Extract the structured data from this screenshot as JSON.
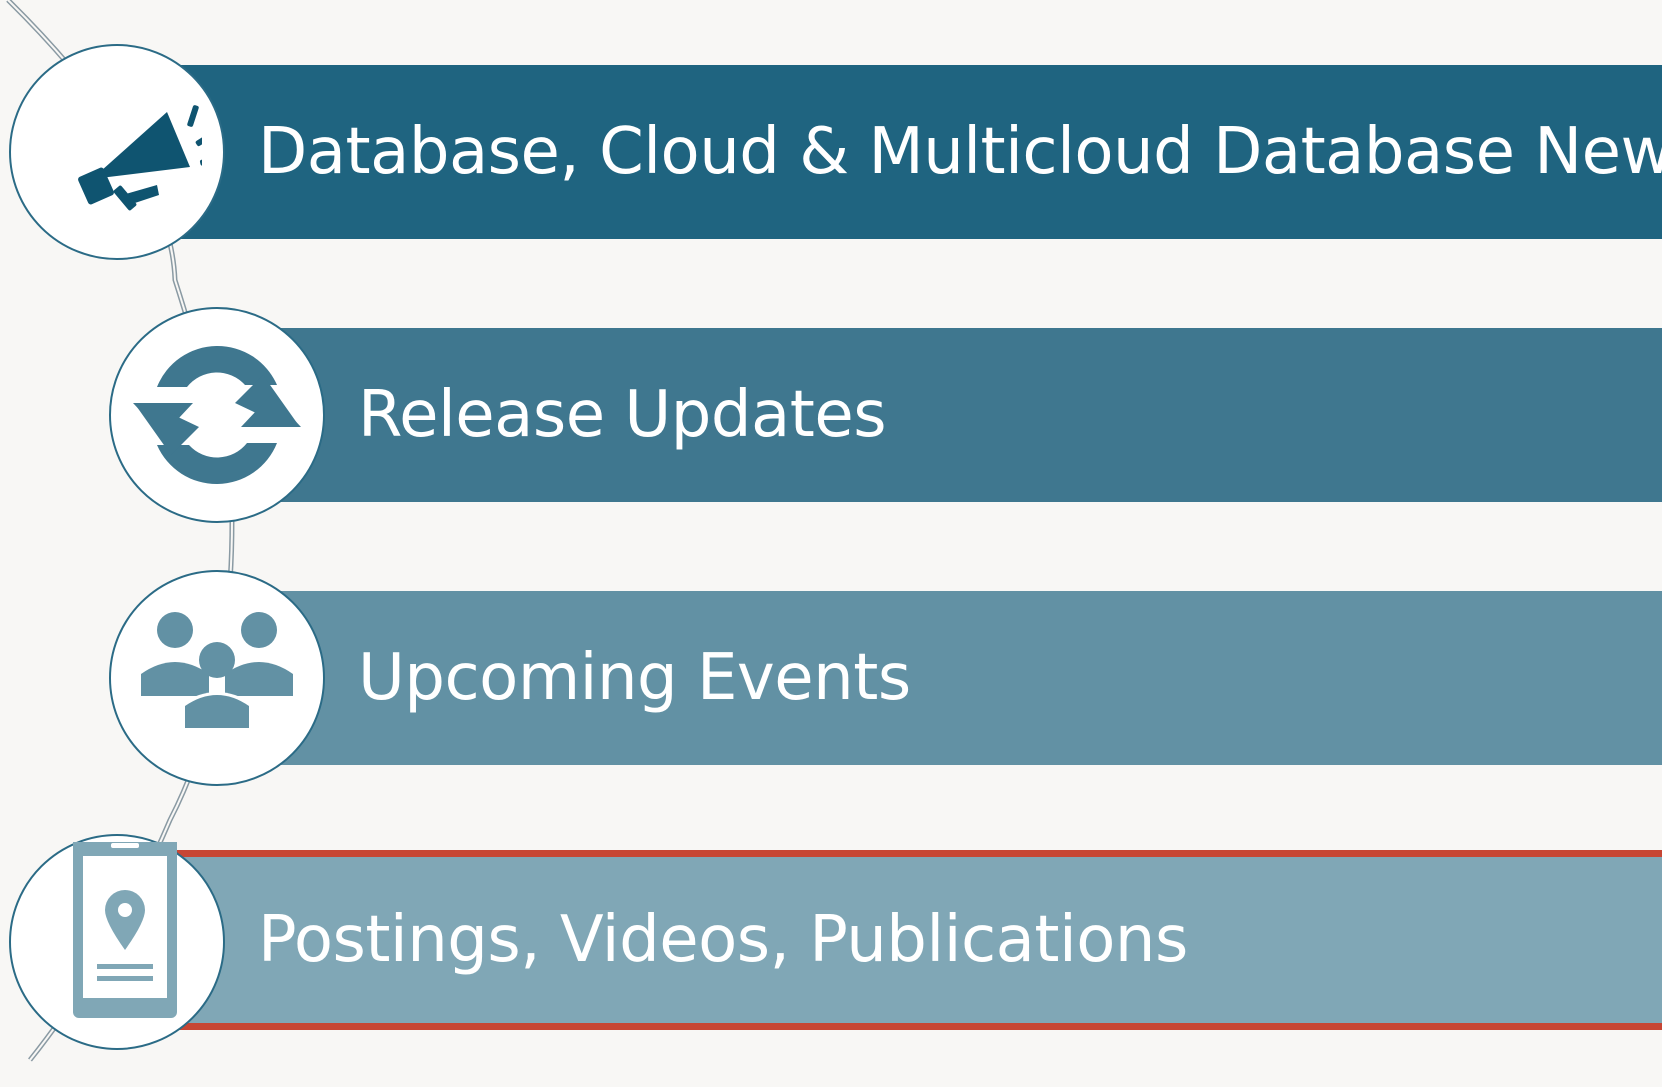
{
  "items": [
    {
      "label": "Database, Cloud & Multicloud Database News",
      "icon": "megaphone-icon"
    },
    {
      "label": "Release Updates",
      "icon": "refresh-icon"
    },
    {
      "label": "Upcoming Events",
      "icon": "people-group-icon"
    },
    {
      "label": "Postings, Videos, Publications",
      "icon": "mobile-location-icon"
    }
  ],
  "colors": {
    "background": "#f8f7f5",
    "band_1": "#1f6480",
    "band_2": "#3f778f",
    "band_3": "#6291a4",
    "band_4": "#80a7b6",
    "accent_red": "#c74634",
    "icon_dark": "#0f5470",
    "icon_mid": "#3f778f",
    "icon_light": "#6291a4"
  }
}
